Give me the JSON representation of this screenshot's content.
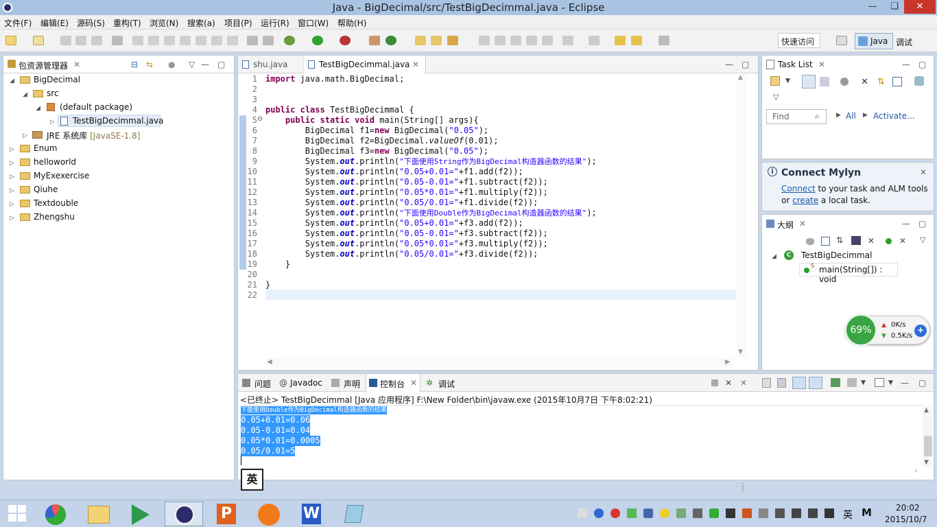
{
  "window": {
    "title": "Java - BigDecimal/src/TestBigDecimmal.java - Eclipse",
    "minimize": "—",
    "restore": "❏",
    "close": "✕"
  },
  "menu": [
    "文件(F)",
    "编辑(E)",
    "源码(S)",
    "重构(T)",
    "浏览(N)",
    "搜索(a)",
    "项目(P)",
    "运行(R)",
    "窗口(W)",
    "帮助(H)"
  ],
  "toolbar": {
    "quick_access": "快速访问",
    "perspective_java": "Java",
    "perspective_debug": "调试"
  },
  "package_explorer": {
    "tab": "包资源管理器",
    "items": [
      {
        "label": "BigDecimal"
      },
      {
        "label": "src"
      },
      {
        "label": "(default package)"
      },
      {
        "label": "TestBigDecimmal.java"
      },
      {
        "label": "JRE 系统库",
        "extra": "[JavaSE-1.8]"
      },
      {
        "label": "Enum"
      },
      {
        "label": "helloworld"
      },
      {
        "label": "MyExexercise"
      },
      {
        "label": "Qiuhe"
      },
      {
        "label": "Textdouble"
      },
      {
        "label": "Zhengshu"
      }
    ]
  },
  "editor": {
    "tabs": [
      "shu.java",
      "TestBigDecimmal.java"
    ],
    "lines": [
      "import java.math.BigDecimal;",
      "",
      "",
      "public class TestBigDecimmal {",
      "    public static void main(String[] args){",
      "        BigDecimal f1=new BigDecimal(\"0.05\");",
      "        BigDecimal f2=BigDecimal.valueOf(0.01);",
      "        BigDecimal f3=new BigDecimal(\"0.05\");",
      "        System.out.println(\"下面使用String作为BigDecimal构造器函数的结果\");",
      "        System.out.println(\"0.05+0.01=\"+f1.add(f2));",
      "        System.out.println(\"0.05-0.01=\"+f1.subtract(f2));",
      "        System.out.println(\"0.05*0.01=\"+f1.multiply(f2));",
      "        System.out.println(\"0.05/0.01=\"+f1.divide(f2));",
      "        System.out.println(\"下面使用Double作为BigDecimal构造器函数的结果\");",
      "        System.out.println(\"0.05+0.01=\"+f3.add(f2));",
      "        System.out.println(\"0.05-0.01=\"+f3.subtract(f2));",
      "        System.out.println(\"0.05*0.01=\"+f3.multiply(f2));",
      "        System.out.println(\"0.05/0.01=\"+f3.divide(f2));",
      "    }",
      "",
      "}",
      ""
    ]
  },
  "task_list": {
    "tab": "Task List",
    "find_placeholder": "Find",
    "all": "All",
    "activate": "Activate..."
  },
  "mylyn": {
    "title": "Connect Mylyn",
    "connect": "Connect",
    "text1": " to your task and ALM tools",
    "or": "or ",
    "create": "create",
    "text2": " a local task."
  },
  "outline": {
    "tab": "大纲",
    "class_name": "TestBigDecimmal",
    "method": "main(String[]) : void"
  },
  "net_widget": {
    "percent": "69%",
    "up": "0K/s",
    "down": "0.5K/s"
  },
  "bottom_tabs": [
    "问题",
    "Javadoc",
    "声明",
    "控制台",
    "调试"
  ],
  "console": {
    "header": "<已终止> TestBigDecimmal [Java 应用程序] F:\\New Folder\\bin\\javaw.exe (2015年10月7日 下午8:02:21)",
    "lines": [
      "下面使用Double作为BigDecimal构造器函数的结果",
      "0.05+0.01=0.06",
      "0.05-0.01=0.04",
      "0.05*0.01=0.0005",
      "0.05/0.01=5"
    ]
  },
  "ime": "英",
  "taskbar": {
    "time": "20:02",
    "date": "2015/10/7",
    "ime": "英",
    "m": "M"
  }
}
